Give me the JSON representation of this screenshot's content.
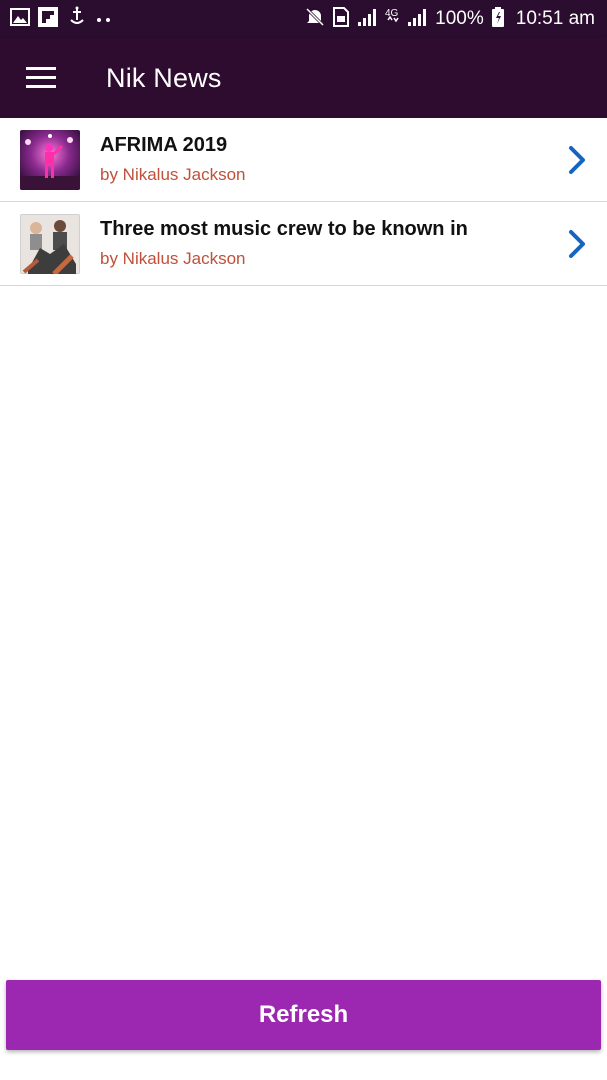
{
  "status_bar": {
    "left_icons": [
      "image-icon",
      "flipboard-icon",
      "usb-debug-icon",
      "more-dots-icon"
    ],
    "right_icons": [
      "mute-icon",
      "sim-icon",
      "signal-icon",
      "4g-icon",
      "signal-2-icon",
      "battery-icon"
    ],
    "battery": "100%",
    "time": "10:51 am"
  },
  "app_bar": {
    "menu_icon": "hamburger-icon",
    "title": "Nik News",
    "background": "#2e0c2f"
  },
  "articles": [
    {
      "title": "AFRIMA 2019",
      "author": "by Nikalus Jackson",
      "thumbnail": "concert-performer-image"
    },
    {
      "title": "Three most music crew to be known in",
      "author": "by Nikalus Jackson",
      "thumbnail": "music-crew-image"
    }
  ],
  "refresh_button": {
    "label": "Refresh",
    "color": "#9c27b0"
  },
  "colors": {
    "author_text": "#c0503a",
    "chevron": "#1565c0"
  }
}
